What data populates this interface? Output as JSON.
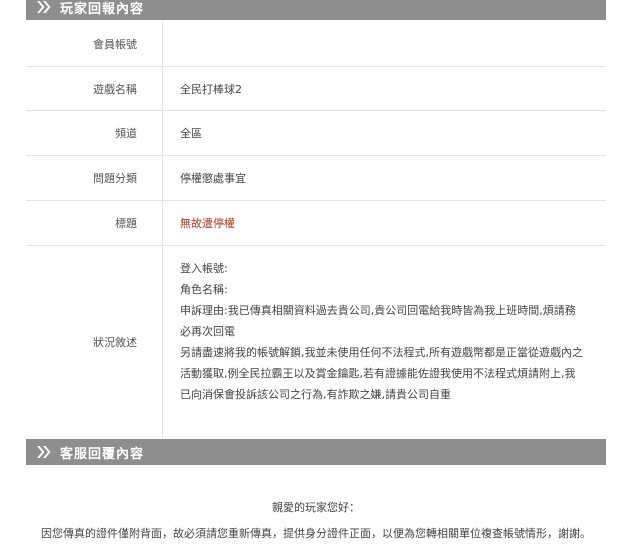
{
  "player_section": {
    "title": "玩家回報內容",
    "fields": [
      {
        "label": "會員帳號",
        "value": ""
      },
      {
        "label": "遊戲名稱",
        "value": "全民打棒球2"
      },
      {
        "label": "頻道",
        "value": "全區"
      },
      {
        "label": "問題分類",
        "value": "停權懲處事宜"
      },
      {
        "label": "標題",
        "value": "無故遭停權"
      }
    ],
    "situation_label": "狀況敘述",
    "situation_lines": [
      "登入帳號:",
      "角色名稱:",
      "申訴理由:我已傳真相關資料過去貴公司,貴公司回電給我時皆為我上班時間,煩請務必再次回電",
      "另請盡速將我的帳號解鎖,我並未使用任何不法程式,所有遊戲幣都是正當從遊戲內之活動獲取,例全民拉霸王以及賞金鑰匙,若有證據能佐證我使用不法程式煩請附上,我已向消保會投訴該公司之行為,有詐欺之嫌,請貴公司自重"
    ]
  },
  "service_section": {
    "title": "客服回覆內容",
    "greeting": "親愛的玩家您好：",
    "message": "因您傳真的證件僅附背面，故必須請您重新傳真，提供身分證件正面，以便為您轉相關單位複查帳號情形，謝謝。"
  },
  "colors": {
    "section_bar": "#8e8e8e",
    "highlight_red": "#b23a1c",
    "divider": "#e4e4e4"
  }
}
